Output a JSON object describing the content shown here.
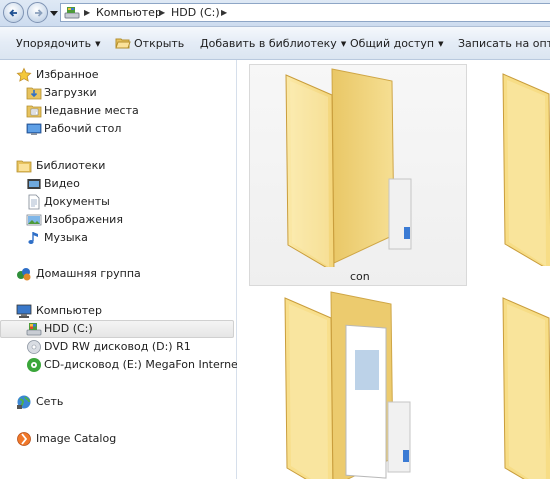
{
  "address": {
    "crumbs": [
      "Компьютер",
      "HDD (C:)"
    ]
  },
  "toolbar": {
    "organize": "Упорядочить",
    "open": "Открыть",
    "add_library": "Добавить в библиотеку",
    "share": "Общий доступ",
    "burn": "Записать на оптиче"
  },
  "nav": {
    "favorites": {
      "title": "Избранное",
      "items": [
        "Загрузки",
        "Недавние места",
        "Рабочий стол"
      ]
    },
    "libraries": {
      "title": "Библиотеки",
      "items": [
        "Видео",
        "Документы",
        "Изображения",
        "Музыка"
      ]
    },
    "homegroup": "Домашняя группа",
    "computer": {
      "title": "Компьютер",
      "items": [
        "HDD (C:)",
        "DVD RW дисковод (D:) R1",
        "CD-дисковод (E:) MegaFon Internet"
      ],
      "selected_index": 0
    },
    "network": "Сеть",
    "image_catalog": "Image Catalog"
  },
  "content": {
    "folders": [
      {
        "name": "con",
        "selected": true
      },
      {
        "name": "",
        "selected": false
      },
      {
        "name": "",
        "selected": false
      },
      {
        "name": "",
        "selected": false
      }
    ]
  },
  "colors": {
    "folder_light": "#fbe7a2",
    "folder_dark": "#e8c45e",
    "selection": "#e8e8e8"
  }
}
